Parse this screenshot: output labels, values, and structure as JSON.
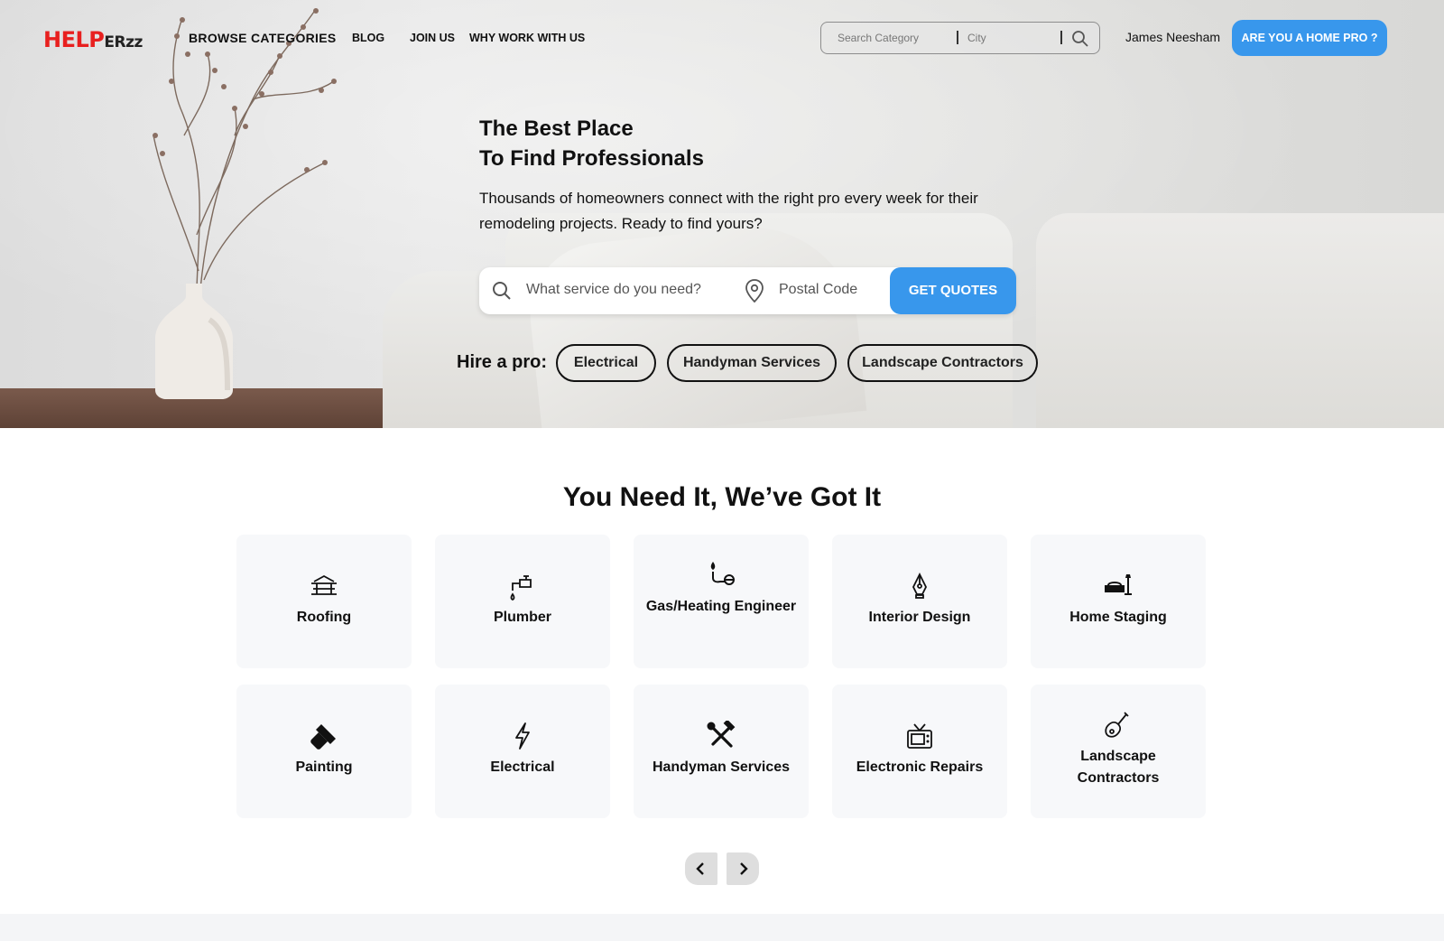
{
  "brand": {
    "logo_main": "HELP",
    "logo_tail": "ERzz",
    "accent": "#3897ec",
    "logo_color": "#e8201f"
  },
  "nav": {
    "browse": "BROWSE CATEGORIES",
    "blog": "BLOG",
    "join": "JOIN US",
    "why": "WHY WORK WITH US",
    "search_category_placeholder": "Search Category",
    "search_city_placeholder": "City",
    "user_name": "James Neesham",
    "pro_button": "ARE YOU A HOME PRO ?"
  },
  "hero": {
    "title_line1": "The Best Place",
    "title_line2": "To Find Professionals",
    "subtitle": "Thousands of homeowners connect with the right pro every week for their remodeling projects. Ready to find yours?",
    "service_placeholder": "What service do you need?",
    "postal_placeholder": "Postal Code",
    "quote_button": "GET QUOTES",
    "hire_label": "Hire a pro:",
    "chips": [
      "Electrical",
      "Handyman Services",
      "Landscape Contractors"
    ]
  },
  "services": {
    "title": "You Need It, We’ve Got It",
    "cards": [
      {
        "label": "Roofing",
        "icon": "roof-icon"
      },
      {
        "label": "Plumber",
        "icon": "faucet-icon"
      },
      {
        "label": "Gas/Heating Engineer",
        "icon": "gas-flame-icon"
      },
      {
        "label": "Interior Design",
        "icon": "pen-nib-icon"
      },
      {
        "label": "Home Staging",
        "icon": "sofa-lamp-icon"
      },
      {
        "label": "Painting",
        "icon": "paint-roller-icon"
      },
      {
        "label": "Electrical",
        "icon": "lightning-icon"
      },
      {
        "label": "Handyman Services",
        "icon": "hammer-wrench-icon"
      },
      {
        "label": "Electronic Repairs",
        "icon": "tv-icon"
      },
      {
        "label": "Landscape Contractors",
        "icon": "shovel-icon"
      }
    ]
  }
}
